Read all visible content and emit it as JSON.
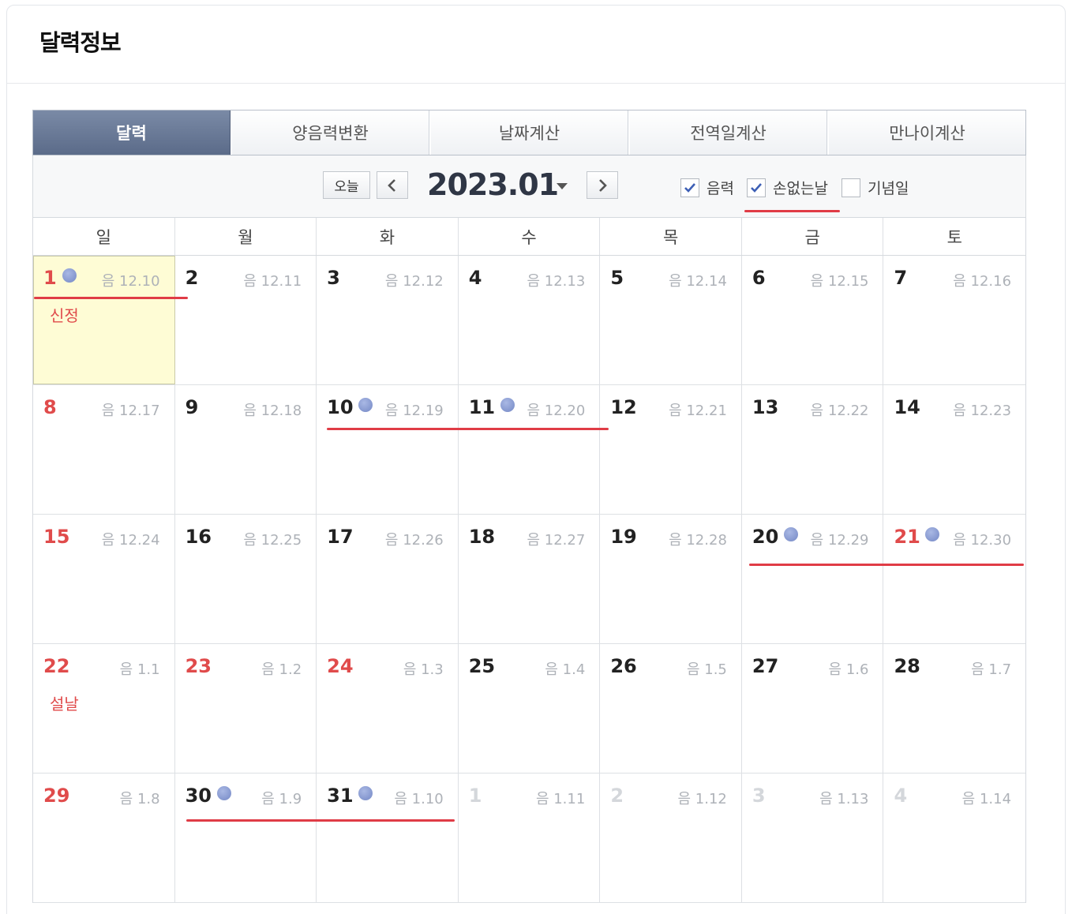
{
  "panel": {
    "title": "달력정보"
  },
  "tabs": [
    {
      "label": "달력",
      "active": true
    },
    {
      "label": "양음력변환",
      "active": false
    },
    {
      "label": "날짜계산",
      "active": false
    },
    {
      "label": "전역일계산",
      "active": false
    },
    {
      "label": "만나이계산",
      "active": false
    }
  ],
  "toolbar": {
    "today_label": "오늘",
    "prev_icon": "chevron-left-icon",
    "next_icon": "chevron-right-icon",
    "month": "2023.01",
    "options": [
      {
        "label": "음력",
        "checked": true
      },
      {
        "label": "손없는날",
        "checked": true
      },
      {
        "label": "기념일",
        "checked": false
      }
    ]
  },
  "weekdays": [
    "일",
    "월",
    "화",
    "수",
    "목",
    "금",
    "토"
  ],
  "colors": {
    "accent_red": "#e03c46",
    "holiday_red": "#e04b4b",
    "dot_blue": "#7c8fcb",
    "today_bg": "#fefcd5",
    "active_tab": "#66769a"
  },
  "weeks": [
    [
      {
        "day": "1",
        "lunar": "음 12.10",
        "red": true,
        "dot": true,
        "today": true,
        "holiday": "신정"
      },
      {
        "day": "2",
        "lunar": "음 12.11"
      },
      {
        "day": "3",
        "lunar": "음 12.12"
      },
      {
        "day": "4",
        "lunar": "음 12.13"
      },
      {
        "day": "5",
        "lunar": "음 12.14"
      },
      {
        "day": "6",
        "lunar": "음 12.15"
      },
      {
        "day": "7",
        "lunar": "음 12.16"
      }
    ],
    [
      {
        "day": "8",
        "lunar": "음 12.17",
        "red": true
      },
      {
        "day": "9",
        "lunar": "음 12.18"
      },
      {
        "day": "10",
        "lunar": "음 12.19",
        "dot": true
      },
      {
        "day": "11",
        "lunar": "음 12.20",
        "dot": true
      },
      {
        "day": "12",
        "lunar": "음 12.21"
      },
      {
        "day": "13",
        "lunar": "음 12.22"
      },
      {
        "day": "14",
        "lunar": "음 12.23"
      }
    ],
    [
      {
        "day": "15",
        "lunar": "음 12.24",
        "red": true
      },
      {
        "day": "16",
        "lunar": "음 12.25"
      },
      {
        "day": "17",
        "lunar": "음 12.26"
      },
      {
        "day": "18",
        "lunar": "음 12.27"
      },
      {
        "day": "19",
        "lunar": "음 12.28"
      },
      {
        "day": "20",
        "lunar": "음 12.29",
        "dot": true
      },
      {
        "day": "21",
        "lunar": "음 12.30",
        "red": true,
        "dot": true
      }
    ],
    [
      {
        "day": "22",
        "lunar": "음 1.1",
        "red": true,
        "holiday": "설날"
      },
      {
        "day": "23",
        "lunar": "음 1.2",
        "red": true
      },
      {
        "day": "24",
        "lunar": "음 1.3",
        "red": true
      },
      {
        "day": "25",
        "lunar": "음 1.4"
      },
      {
        "day": "26",
        "lunar": "음 1.5"
      },
      {
        "day": "27",
        "lunar": "음 1.6"
      },
      {
        "day": "28",
        "lunar": "음 1.7"
      }
    ],
    [
      {
        "day": "29",
        "lunar": "음 1.8",
        "red": true
      },
      {
        "day": "30",
        "lunar": "음 1.9",
        "dot": true
      },
      {
        "day": "31",
        "lunar": "음 1.10",
        "dot": true
      },
      {
        "day": "1",
        "lunar": "음 1.11",
        "muted": true
      },
      {
        "day": "2",
        "lunar": "음 1.12",
        "muted": true
      },
      {
        "day": "3",
        "lunar": "음 1.13",
        "muted": true
      },
      {
        "day": "4",
        "lunar": "음 1.14",
        "muted": true
      }
    ]
  ]
}
